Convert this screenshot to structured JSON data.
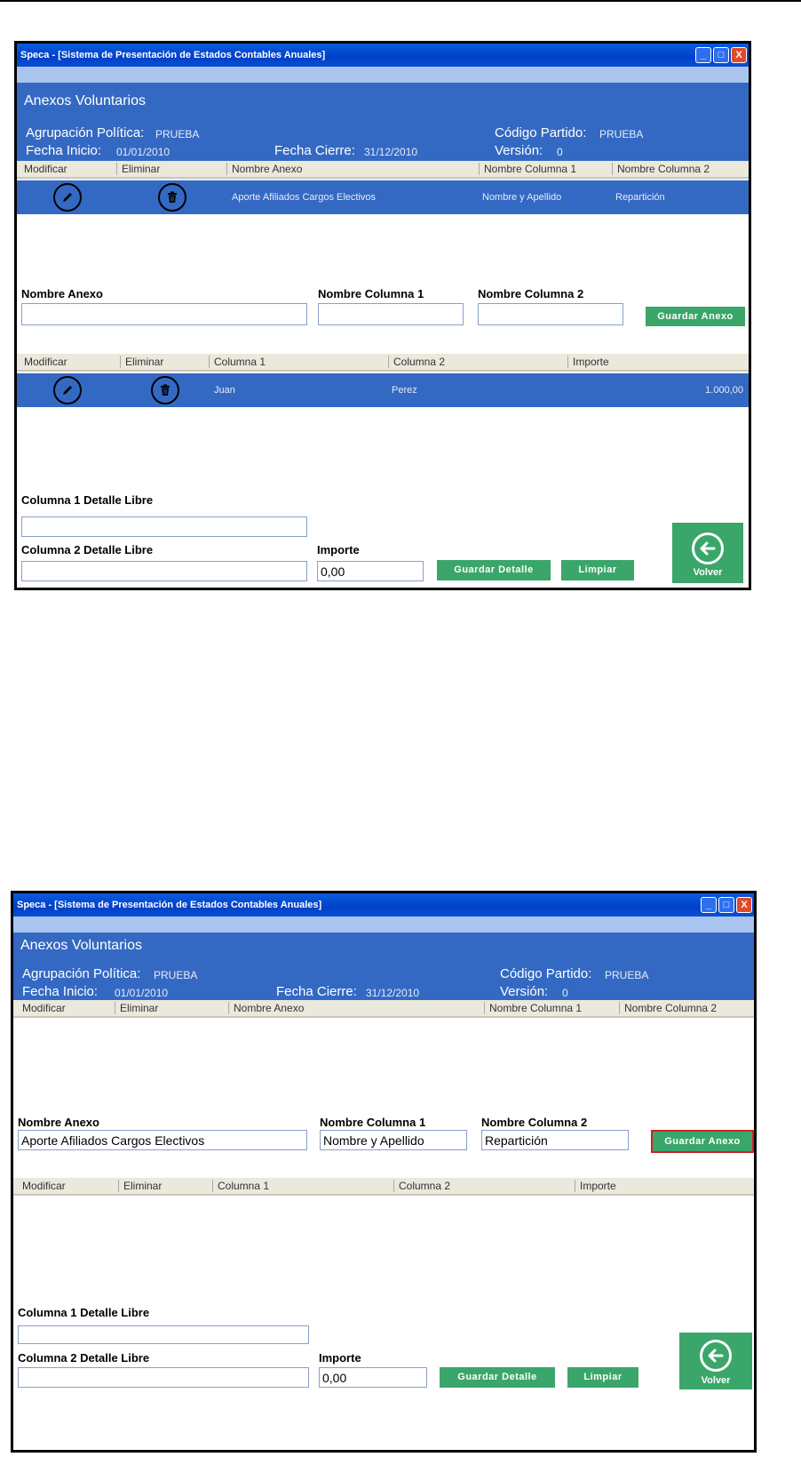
{
  "window": {
    "title": "Speca - [Sistema de Presentación de Estados Contables Anuales]",
    "buttons": [
      "_",
      "□",
      "X"
    ]
  },
  "header": {
    "section": "Anexos Voluntarios",
    "agrupacion_label": "Agrupación Política:",
    "agrupacion_value": "PRUEBA",
    "codigo_label": "Código Partido:",
    "codigo_value": "PRUEBA",
    "fecha_inicio_label": "Fecha Inicio:",
    "fecha_inicio_value": "01/01/2010",
    "fecha_cierre_label": "Fecha Cierre:",
    "fecha_cierre_value": "31/12/2010",
    "version_label": "Versión:",
    "version_value": "0"
  },
  "anexos_table": {
    "columns": [
      "Modificar",
      "Eliminar",
      "Nombre Anexo",
      "Nombre Columna 1",
      "Nombre Columna 2"
    ]
  },
  "detalle_table": {
    "columns": [
      "Modificar",
      "Eliminar",
      "Columna 1",
      "Columna 2",
      "Importe"
    ]
  },
  "form": {
    "nombre_anexo_label": "Nombre Anexo",
    "nombre_col1_label": "Nombre Columna 1",
    "nombre_col2_label": "Nombre Columna 2",
    "guardar_anexo": "Guardar Anexo",
    "col1_detalle_label": "Columna 1 Detalle Libre",
    "col2_detalle_label": "Columna 2 Detalle Libre",
    "importe_label": "Importe",
    "guardar_detalle": "Guardar Detalle",
    "limpiar": "Limpiar",
    "volver": "Volver"
  },
  "shot1": {
    "anexo_row": {
      "nombre_anexo": "Aporte Afiliados Cargos Electivos",
      "nombre_col1": "Nombre y Apellido",
      "nombre_col2": "Repartición"
    },
    "detalle_row": {
      "columna1": "Juan",
      "columna2": "Perez",
      "importe": "1.000,00"
    },
    "inputs": {
      "nombre_anexo": "",
      "nombre_col1": "",
      "nombre_col2": "",
      "col1_detalle": "",
      "col2_detalle": "",
      "importe": "0,00"
    }
  },
  "shot2": {
    "inputs": {
      "nombre_anexo": "Aporte Afiliados Cargos Electivos",
      "nombre_col1": "Nombre y Apellido",
      "nombre_col2": "Repartición",
      "col1_detalle": "",
      "col2_detalle": "",
      "importe": "0,00"
    }
  },
  "colors": {
    "header_blue": "#3469c3",
    "button_green": "#3aa66a",
    "highlight_red": "#d0202a"
  },
  "icons": [
    "pencil-icon",
    "trash-icon",
    "arrow-left-icon"
  ]
}
